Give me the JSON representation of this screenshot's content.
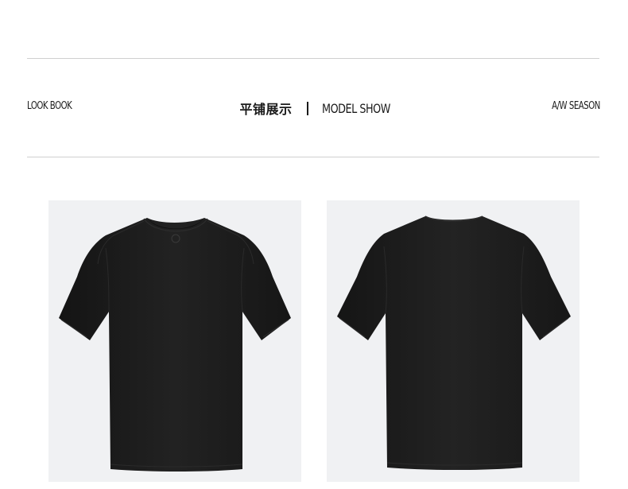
{
  "header": {
    "left_label": "LOOK BOOK",
    "title_cn": "平铺展示",
    "title_en": "MODEL SHOW",
    "right_label": "A/W SEASON"
  },
  "photos": [
    {
      "view": "front",
      "icon": "tshirt-front-icon",
      "color": "#1b1b1b"
    },
    {
      "view": "back",
      "icon": "tshirt-back-icon",
      "color": "#1b1b1b"
    }
  ],
  "colors": {
    "background": "#ffffff",
    "photo_background": "#f0f1f3",
    "rule": "#cfcfcf",
    "text": "#1a1a1a"
  }
}
